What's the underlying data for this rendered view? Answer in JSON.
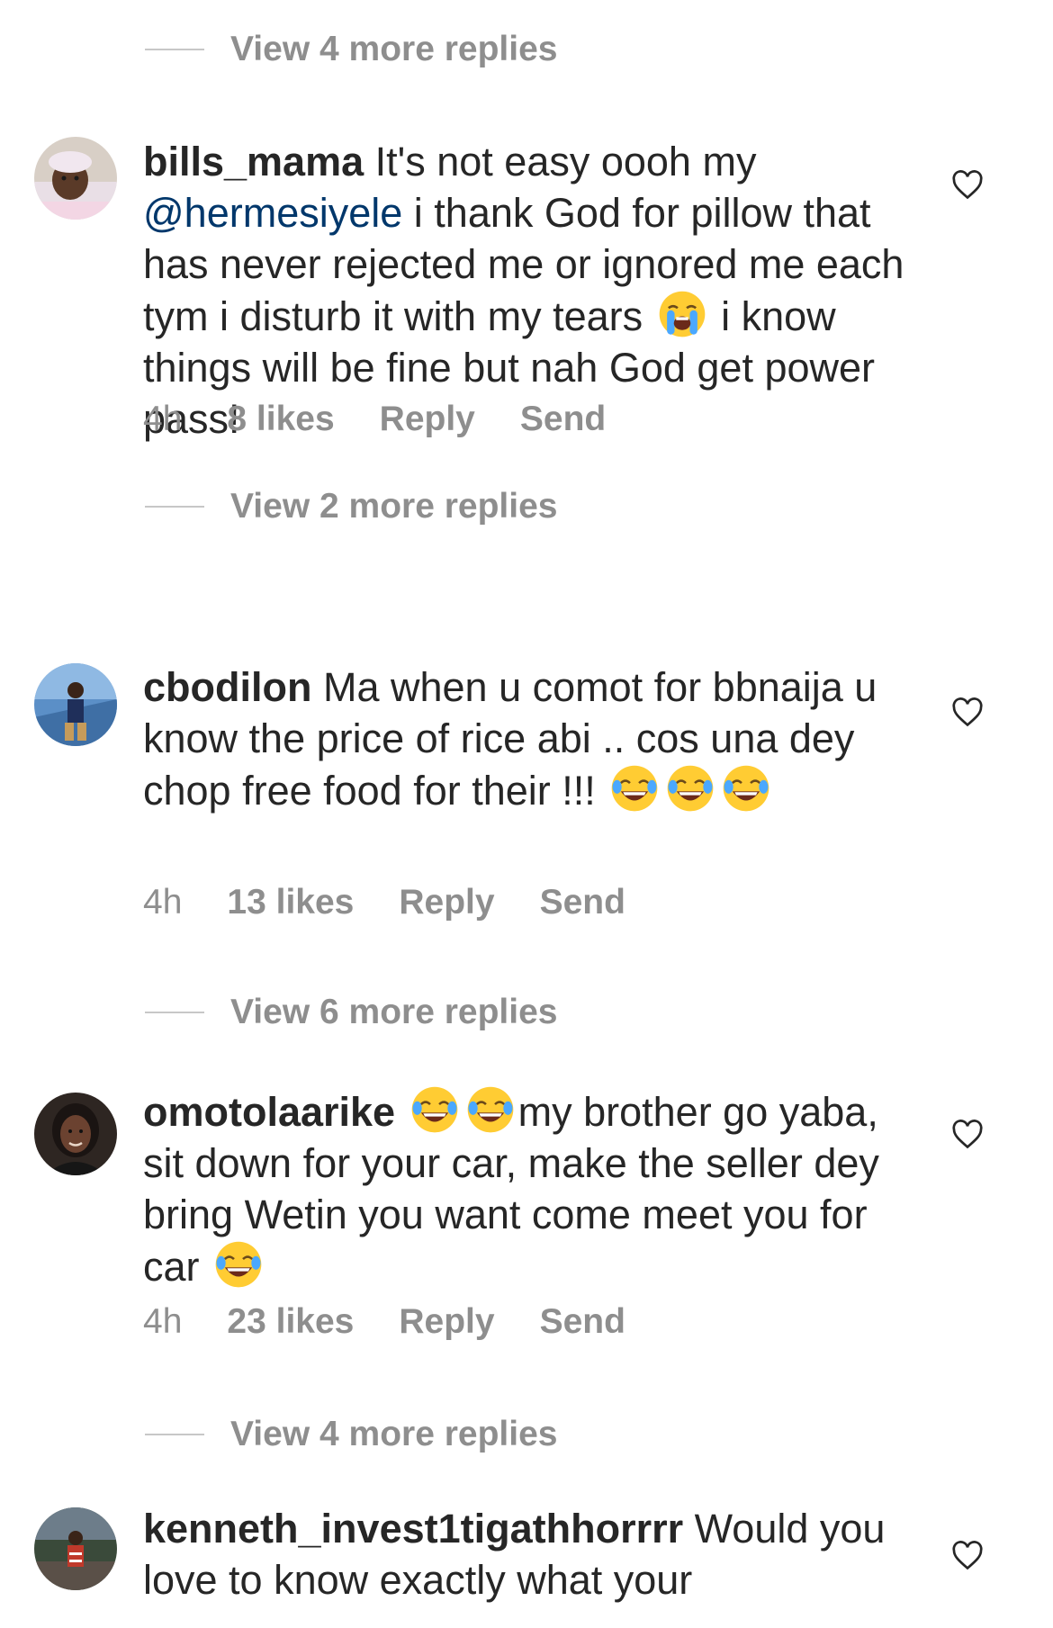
{
  "view_replies": [
    {
      "label": "View 4 more replies"
    },
    {
      "label": "View 2 more replies"
    },
    {
      "label": "View 6 more replies"
    },
    {
      "label": "View 4 more replies"
    }
  ],
  "comments": [
    {
      "username": "bills_mama",
      "text_part1": " It's not easy oooh my ",
      "mention": "@hermesiyele",
      "text_part2": " i thank God for pillow that has never rejected me or ignored me each tym i disturb it with my tears ",
      "emoji1": "loudly-crying-face-emoji",
      "text_part3": " i know things will be fine but nah God get power pass!",
      "time": "4h",
      "likes": "8 likes",
      "reply": "Reply",
      "send": "Send"
    },
    {
      "username": "cbodilon",
      "text_part1": " Ma when u comot for bbnaija u know the price of rice abi .. cos una dey chop free food for their !!! ",
      "emoji": "face-with-tears-of-joy-emoji",
      "time": "4h",
      "likes": "13 likes",
      "reply": "Reply",
      "send": "Send"
    },
    {
      "username": "omotolaarike",
      "text_part1": "my brother go yaba, sit down for your car, make the seller dey bring Wetin you want come meet you for car ",
      "emoji": "face-with-tears-of-joy-emoji",
      "time": "4h",
      "likes": "23 likes",
      "reply": "Reply",
      "send": "Send"
    },
    {
      "username": "kenneth_invest1tigathhorrrr",
      "text_part1": " Would you love to know exactly what your"
    }
  ],
  "colors": {
    "text": "#262626",
    "secondary": "#8e8e8e",
    "mention": "#00376b",
    "divider": "#c7c7c7"
  }
}
